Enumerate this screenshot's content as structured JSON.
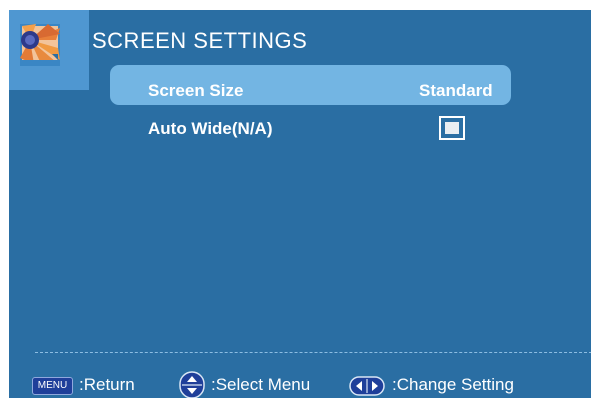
{
  "header": {
    "title": "SCREEN SETTINGS",
    "thumbnail_icon": "sunflower-picture-icon"
  },
  "menu": {
    "items": [
      {
        "label": "Screen Size",
        "value": "Standard",
        "selected": true
      },
      {
        "label": "Auto Wide(N/A)",
        "control": "checkbox",
        "checked": false
      }
    ]
  },
  "help_bar": {
    "menu_key_label": "MENU",
    "return_text": ":Return",
    "select_text": ":Select Menu",
    "change_text": ":Change Setting",
    "updown_icon": "up-down-arrows-icon",
    "leftright_icon": "left-right-arrows-icon"
  },
  "colors": {
    "background": "#2a6ea3",
    "selected_row": "#73b5e3",
    "thumbnail_panel": "#4f97d1",
    "menu_key": "#1f3f9a",
    "text": "#ffffff"
  }
}
